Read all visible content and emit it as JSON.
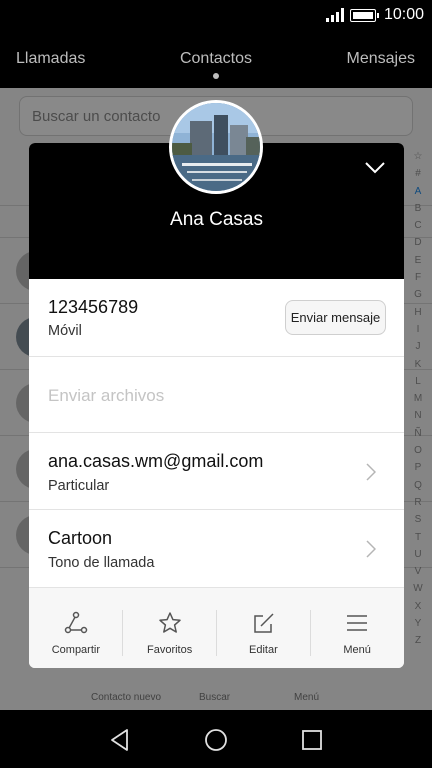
{
  "status": {
    "time": "10:00"
  },
  "tabs": {
    "left": "Llamadas",
    "center": "Contactos",
    "right": "Mensajes"
  },
  "background": {
    "search_placeholder": "Buscar un contacto",
    "alphabet": [
      "☆",
      "#",
      "A",
      "B",
      "C",
      "D",
      "E",
      "F",
      "G",
      "H",
      "I",
      "J",
      "K",
      "L",
      "M",
      "N",
      "Ñ",
      "O",
      "P",
      "Q",
      "R",
      "S",
      "T",
      "U",
      "V",
      "W",
      "X",
      "Y",
      "Z"
    ],
    "active_letter": "A",
    "bottom_bar": {
      "new_contact": "Contacto nuevo",
      "search": "Buscar",
      "menu": "Menú"
    }
  },
  "contact": {
    "name": "Ana Casas",
    "phone": {
      "number": "123456789",
      "type": "Móvil",
      "action": "Enviar mensaje"
    },
    "send_files": "Enviar archivos",
    "email": {
      "address": "ana.casas.wm@gmail.com",
      "type": "Particular"
    },
    "ringtone": {
      "name": "Cartoon",
      "label": "Tono de llamada"
    }
  },
  "actions": [
    {
      "label": "Compartir",
      "icon": "share-icon"
    },
    {
      "label": "Favoritos",
      "icon": "star-icon"
    },
    {
      "label": "Editar",
      "icon": "edit-icon"
    },
    {
      "label": "Menú",
      "icon": "menu-icon"
    }
  ],
  "colors": {
    "accent": "#1e88e5",
    "header": "#000000"
  }
}
